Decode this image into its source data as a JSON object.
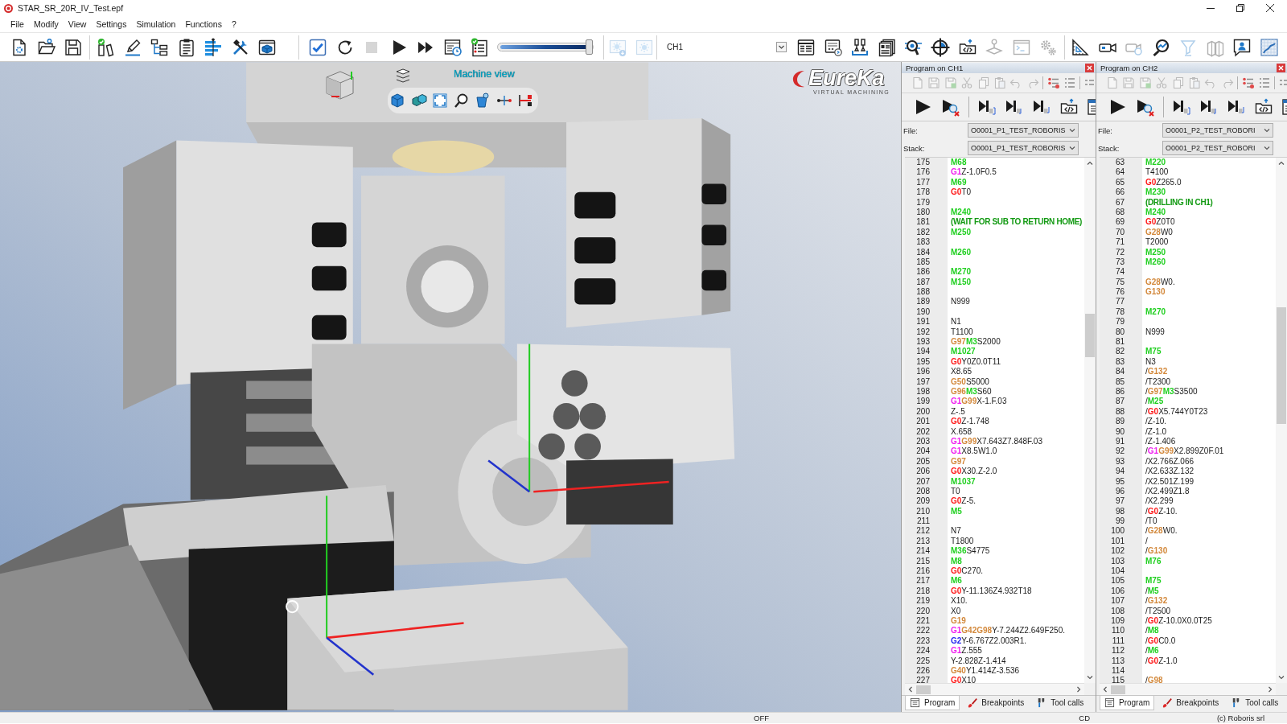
{
  "window": {
    "title": "STAR_SR_20R_IV_Test.epf"
  },
  "menu": [
    "File",
    "Modify",
    "View",
    "Settings",
    "Simulation",
    "Functions",
    "?"
  ],
  "toolbar": [
    {
      "buttons": [
        {
          "disabled": false
        },
        {
          "disabled": false
        },
        {
          "disabled": false
        }
      ]
    },
    {
      "buttons": [
        {
          "disabled": false
        },
        {
          "disabled": false
        },
        {
          "disabled": false
        },
        {
          "disabled": false
        },
        {
          "disabled": false
        },
        {
          "disabled": false
        },
        {
          "disabled": false
        }
      ]
    },
    {
      "buttons": [
        {
          "disabled": false
        },
        {
          "disabled": false
        },
        {
          "disabled": true
        },
        {
          "disabled": false
        },
        {
          "disabled": false
        },
        {
          "disabled": false
        },
        {
          "disabled": false
        }
      ],
      "slider": {
        "level": 1
      }
    },
    {
      "buttons": [
        {
          "disabled": true
        },
        {
          "disabled": true
        }
      ]
    },
    {
      "select": {
        "value": "CH1"
      },
      "buttons": [
        {
          "disabled": false
        },
        {
          "disabled": false
        },
        {
          "disabled": false
        },
        {
          "disabled": false
        },
        {
          "disabled": false
        },
        {
          "disabled": false
        },
        {
          "disabled": false
        },
        {
          "disabled": true
        },
        {
          "disabled": true
        },
        {
          "disabled": true
        }
      ]
    },
    {
      "buttons": [
        {
          "disabled": false
        },
        {
          "disabled": false
        },
        {
          "disabled": true
        },
        {
          "disabled": false
        },
        {
          "disabled": true
        },
        {
          "disabled": true
        },
        {
          "disabled": false
        },
        {
          "disabled": false
        }
      ]
    }
  ],
  "viewport": {
    "title": "Machine view",
    "logo": {
      "name": "EureKa",
      "tagline": "VIRTUAL MACHINING"
    }
  },
  "panels": [
    {
      "title": "Program on CH1",
      "edit_tools": [
        {
          "disabled": true
        },
        {
          "disabled": true
        },
        {
          "disabled": true
        },
        {
          "disabled": true
        },
        {
          "disabled": true
        },
        {
          "disabled": true
        },
        {
          "disabled": true
        },
        {
          "disabled": true
        },
        {
          "disabled": false
        },
        {
          "disabled": false
        },
        {
          "disabled": false
        }
      ],
      "file": {
        "label": "File:",
        "value": "O0001_P1_TEST_ROBORIS"
      },
      "stack": {
        "label": "Stack:",
        "value": "O0001_P1_TEST_ROBORIS"
      },
      "lines": [
        {
          "number": "175",
          "code": [
            {
              "kind": "m",
              "text": "M68"
            }
          ]
        },
        {
          "number": "176",
          "code": [
            {
              "kind": "g1",
              "text": "G1"
            },
            {
              "kind": "text",
              "text": "Z-1.0F0.5"
            }
          ]
        },
        {
          "number": "177",
          "code": [
            {
              "kind": "m",
              "text": "M69"
            }
          ]
        },
        {
          "number": "178",
          "code": [
            {
              "kind": "g0",
              "text": "G0"
            },
            {
              "kind": "text",
              "text": "T0"
            }
          ]
        },
        {
          "number": "179"
        },
        {
          "number": "180",
          "code": [
            {
              "kind": "m",
              "text": "M240"
            }
          ]
        },
        {
          "number": "181",
          "code": [
            {
              "kind": "comment",
              "text": "(WAIT FOR SUB TO RETURN HOME)"
            }
          ]
        },
        {
          "number": "182",
          "code": [
            {
              "kind": "m",
              "text": "M250"
            }
          ]
        },
        {
          "number": "183"
        },
        {
          "number": "184",
          "code": [
            {
              "kind": "m",
              "text": "M260"
            }
          ]
        },
        {
          "number": "185"
        },
        {
          "number": "186",
          "code": [
            {
              "kind": "m",
              "text": "M270"
            }
          ]
        },
        {
          "number": "187",
          "code": [
            {
              "kind": "m",
              "text": "M150"
            }
          ]
        },
        {
          "number": "188"
        },
        {
          "number": "189",
          "code": [
            {
              "kind": "text",
              "text": "N999"
            }
          ]
        },
        {
          "number": "190"
        },
        {
          "number": "191",
          "code": [
            {
              "kind": "text",
              "text": "N1"
            }
          ]
        },
        {
          "number": "192",
          "code": [
            {
              "kind": "text",
              "text": "T1100"
            }
          ]
        },
        {
          "number": "193",
          "code": [
            {
              "kind": "g",
              "text": "G97"
            },
            {
              "kind": "m",
              "text": "M3"
            },
            {
              "kind": "text",
              "text": "S2000"
            }
          ]
        },
        {
          "number": "194",
          "code": [
            {
              "kind": "m",
              "text": "M1027"
            }
          ]
        },
        {
          "number": "195",
          "code": [
            {
              "kind": "g0",
              "text": "G0"
            },
            {
              "kind": "text",
              "text": "Y0Z0.0T11"
            }
          ]
        },
        {
          "number": "196",
          "code": [
            {
              "kind": "text",
              "text": "X8.65"
            }
          ]
        },
        {
          "number": "197",
          "code": [
            {
              "kind": "g",
              "text": "G50"
            },
            {
              "kind": "text",
              "text": "S5000"
            }
          ]
        },
        {
          "number": "198",
          "code": [
            {
              "kind": "g",
              "text": "G96"
            },
            {
              "kind": "m",
              "text": "M3"
            },
            {
              "kind": "text",
              "text": "S60"
            }
          ]
        },
        {
          "number": "199",
          "code": [
            {
              "kind": "g1",
              "text": "G1"
            },
            {
              "kind": "g",
              "text": "G99"
            },
            {
              "kind": "text",
              "text": "X-1.F.03"
            }
          ]
        },
        {
          "number": "200",
          "code": [
            {
              "kind": "text",
              "text": "Z-.5"
            }
          ]
        },
        {
          "number": "201",
          "code": [
            {
              "kind": "g0",
              "text": "G0"
            },
            {
              "kind": "text",
              "text": "Z-1.748"
            }
          ]
        },
        {
          "number": "202",
          "code": [
            {
              "kind": "text",
              "text": "X.658"
            }
          ]
        },
        {
          "number": "203",
          "code": [
            {
              "kind": "g1",
              "text": "G1"
            },
            {
              "kind": "g",
              "text": "G99"
            },
            {
              "kind": "text",
              "text": "X7.643Z7.848F.03"
            }
          ]
        },
        {
          "number": "204",
          "code": [
            {
              "kind": "g1",
              "text": "G1"
            },
            {
              "kind": "text",
              "text": "X8.5W1.0"
            }
          ]
        },
        {
          "number": "205",
          "code": [
            {
              "kind": "g",
              "text": "G97"
            }
          ]
        },
        {
          "number": "206",
          "code": [
            {
              "kind": "g0",
              "text": "G0"
            },
            {
              "kind": "text",
              "text": "X30.Z-2.0"
            }
          ]
        },
        {
          "number": "207",
          "code": [
            {
              "kind": "m",
              "text": "M1037"
            }
          ]
        },
        {
          "number": "208",
          "code": [
            {
              "kind": "text",
              "text": "T0"
            }
          ]
        },
        {
          "number": "209",
          "code": [
            {
              "kind": "g0",
              "text": "G0"
            },
            {
              "kind": "text",
              "text": "Z-5."
            }
          ]
        },
        {
          "number": "210",
          "code": [
            {
              "kind": "m",
              "text": "M5"
            }
          ]
        },
        {
          "number": "211"
        },
        {
          "number": "212",
          "code": [
            {
              "kind": "text",
              "text": "N7"
            }
          ]
        },
        {
          "number": "213",
          "code": [
            {
              "kind": "text",
              "text": "T1800"
            }
          ]
        },
        {
          "number": "214",
          "code": [
            {
              "kind": "m",
              "text": "M36"
            },
            {
              "kind": "text",
              "text": "S4775"
            }
          ]
        },
        {
          "number": "215",
          "code": [
            {
              "kind": "m",
              "text": "M8"
            }
          ]
        },
        {
          "number": "216",
          "code": [
            {
              "kind": "g0",
              "text": "G0"
            },
            {
              "kind": "text",
              "text": "C270."
            }
          ]
        },
        {
          "number": "217",
          "code": [
            {
              "kind": "m",
              "text": "M6"
            }
          ]
        },
        {
          "number": "218",
          "code": [
            {
              "kind": "g0",
              "text": "G0"
            },
            {
              "kind": "text",
              "text": "Y-11.136Z4.932T18"
            }
          ]
        },
        {
          "number": "219",
          "code": [
            {
              "kind": "text",
              "text": "X10."
            }
          ]
        },
        {
          "number": "220",
          "code": [
            {
              "kind": "text",
              "text": "X0"
            }
          ]
        },
        {
          "number": "221",
          "code": [
            {
              "kind": "g",
              "text": "G19"
            }
          ]
        },
        {
          "number": "222",
          "code": [
            {
              "kind": "g1",
              "text": "G1"
            },
            {
              "kind": "g",
              "text": "G42G98"
            },
            {
              "kind": "text",
              "text": "Y-7.244Z2.649F250."
            }
          ]
        },
        {
          "number": "223",
          "code": [
            {
              "kind": "g2",
              "text": "G2"
            },
            {
              "kind": "text",
              "text": "Y-6.767Z2.003R1."
            }
          ]
        },
        {
          "number": "224",
          "code": [
            {
              "kind": "g1",
              "text": "G1"
            },
            {
              "kind": "text",
              "text": "Z.555"
            }
          ]
        },
        {
          "number": "225",
          "code": [
            {
              "kind": "text",
              "text": "Y-2.828Z-1.414"
            }
          ]
        },
        {
          "number": "226",
          "code": [
            {
              "kind": "g",
              "text": "G40"
            },
            {
              "kind": "text",
              "text": "Y1.414Z-3.536"
            }
          ]
        },
        {
          "number": "227",
          "code": [
            {
              "kind": "g0",
              "text": "G0"
            },
            {
              "kind": "text",
              "text": "X10"
            }
          ]
        }
      ],
      "tabs": [
        {
          "label": "Program",
          "selected": true
        },
        {
          "label": "Breakpoints",
          "selected": false
        },
        {
          "label": "Tool calls",
          "selected": false
        }
      ]
    },
    {
      "title": "Program on CH2",
      "edit_tools": [
        {
          "disabled": true
        },
        {
          "disabled": true
        },
        {
          "disabled": true
        },
        {
          "disabled": true
        },
        {
          "disabled": true
        },
        {
          "disabled": true
        },
        {
          "disabled": true
        },
        {
          "disabled": true
        },
        {
          "disabled": false
        },
        {
          "disabled": false
        },
        {
          "disabled": false
        }
      ],
      "file": {
        "label": "File:",
        "value": "O0001_P2_TEST_ROBORI"
      },
      "stack": {
        "label": "Stack:",
        "value": "O0001_P2_TEST_ROBORI"
      },
      "lines": [
        {
          "number": "63",
          "code": [
            {
              "kind": "m",
              "text": "M220"
            }
          ]
        },
        {
          "number": "64",
          "code": [
            {
              "kind": "text",
              "text": "T4100"
            }
          ]
        },
        {
          "number": "65",
          "code": [
            {
              "kind": "g0",
              "text": "G0"
            },
            {
              "kind": "text",
              "text": "Z265.0"
            }
          ]
        },
        {
          "number": "66",
          "code": [
            {
              "kind": "m",
              "text": "M230"
            }
          ]
        },
        {
          "number": "67",
          "code": [
            {
              "kind": "comment",
              "text": "(DRILLING IN CH1)"
            }
          ]
        },
        {
          "number": "68",
          "code": [
            {
              "kind": "m",
              "text": "M240"
            }
          ]
        },
        {
          "number": "69",
          "code": [
            {
              "kind": "g0",
              "text": "G0"
            },
            {
              "kind": "text",
              "text": "Z0T0"
            }
          ]
        },
        {
          "number": "70",
          "code": [
            {
              "kind": "g",
              "text": "G28"
            },
            {
              "kind": "text",
              "text": "W0"
            }
          ]
        },
        {
          "number": "71",
          "code": [
            {
              "kind": "text",
              "text": "T2000"
            }
          ]
        },
        {
          "number": "72",
          "code": [
            {
              "kind": "m",
              "text": "M250"
            }
          ]
        },
        {
          "number": "73",
          "code": [
            {
              "kind": "m",
              "text": "M260"
            }
          ]
        },
        {
          "number": "74"
        },
        {
          "number": "75",
          "code": [
            {
              "kind": "g",
              "text": "G28"
            },
            {
              "kind": "text",
              "text": "W0."
            }
          ]
        },
        {
          "number": "76",
          "code": [
            {
              "kind": "g",
              "text": "G130"
            }
          ]
        },
        {
          "number": "77"
        },
        {
          "number": "78",
          "code": [
            {
              "kind": "m",
              "text": "M270"
            }
          ]
        },
        {
          "number": "79"
        },
        {
          "number": "80",
          "code": [
            {
              "kind": "text",
              "text": "N999"
            }
          ]
        },
        {
          "number": "81"
        },
        {
          "number": "82",
          "code": [
            {
              "kind": "m",
              "text": "M75"
            }
          ]
        },
        {
          "number": "83",
          "code": [
            {
              "kind": "text",
              "text": "N3"
            }
          ]
        },
        {
          "number": "84",
          "code": [
            {
              "kind": "text",
              "text": "/"
            },
            {
              "kind": "g",
              "text": "G132"
            }
          ]
        },
        {
          "number": "85",
          "code": [
            {
              "kind": "text",
              "text": "/T2300"
            }
          ]
        },
        {
          "number": "86",
          "code": [
            {
              "kind": "text",
              "text": "/"
            },
            {
              "kind": "g",
              "text": "G97"
            },
            {
              "kind": "m",
              "text": "M3"
            },
            {
              "kind": "text",
              "text": "S3500"
            }
          ]
        },
        {
          "number": "87",
          "code": [
            {
              "kind": "text",
              "text": "/"
            },
            {
              "kind": "m",
              "text": "M25"
            }
          ]
        },
        {
          "number": "88",
          "code": [
            {
              "kind": "text",
              "text": "/"
            },
            {
              "kind": "g0",
              "text": "G0"
            },
            {
              "kind": "text",
              "text": "X5.744Y0T23"
            }
          ]
        },
        {
          "number": "89",
          "code": [
            {
              "kind": "text",
              "text": "/Z-10."
            }
          ]
        },
        {
          "number": "90",
          "code": [
            {
              "kind": "text",
              "text": "/Z-1.0"
            }
          ]
        },
        {
          "number": "91",
          "code": [
            {
              "kind": "text",
              "text": "/Z-1.406"
            }
          ]
        },
        {
          "number": "92",
          "code": [
            {
              "kind": "text",
              "text": "/"
            },
            {
              "kind": "g1",
              "text": "G1"
            },
            {
              "kind": "g",
              "text": "G99"
            },
            {
              "kind": "text",
              "text": "X2.899Z0F.01"
            }
          ]
        },
        {
          "number": "93",
          "code": [
            {
              "kind": "text",
              "text": "/X2.766Z.066"
            }
          ]
        },
        {
          "number": "94",
          "code": [
            {
              "kind": "text",
              "text": "/X2.633Z.132"
            }
          ]
        },
        {
          "number": "95",
          "code": [
            {
              "kind": "text",
              "text": "/X2.501Z.199"
            }
          ]
        },
        {
          "number": "96",
          "code": [
            {
              "kind": "text",
              "text": "/X2.499Z1.8"
            }
          ]
        },
        {
          "number": "97",
          "code": [
            {
              "kind": "text",
              "text": "/X2.299"
            }
          ]
        },
        {
          "number": "98",
          "code": [
            {
              "kind": "text",
              "text": "/"
            },
            {
              "kind": "g0",
              "text": "G0"
            },
            {
              "kind": "text",
              "text": "Z-10."
            }
          ]
        },
        {
          "number": "99",
          "code": [
            {
              "kind": "text",
              "text": "/T0"
            }
          ]
        },
        {
          "number": "100",
          "code": [
            {
              "kind": "text",
              "text": "/"
            },
            {
              "kind": "g",
              "text": "G28"
            },
            {
              "kind": "text",
              "text": "W0."
            }
          ]
        },
        {
          "number": "101",
          "code": [
            {
              "kind": "text",
              "text": "/"
            }
          ]
        },
        {
          "number": "102",
          "code": [
            {
              "kind": "text",
              "text": "/"
            },
            {
              "kind": "g",
              "text": "G130"
            }
          ]
        },
        {
          "number": "103",
          "code": [
            {
              "kind": "m",
              "text": "M76"
            }
          ]
        },
        {
          "number": "104"
        },
        {
          "number": "105",
          "code": [
            {
              "kind": "m",
              "text": "M75"
            }
          ]
        },
        {
          "number": "106",
          "code": [
            {
              "kind": "text",
              "text": "/"
            },
            {
              "kind": "m",
              "text": "M5"
            }
          ]
        },
        {
          "number": "107",
          "code": [
            {
              "kind": "text",
              "text": "/"
            },
            {
              "kind": "g",
              "text": "G132"
            }
          ]
        },
        {
          "number": "108",
          "code": [
            {
              "kind": "text",
              "text": "/T2500"
            }
          ]
        },
        {
          "number": "109",
          "code": [
            {
              "kind": "text",
              "text": "/"
            },
            {
              "kind": "g0",
              "text": "G0"
            },
            {
              "kind": "text",
              "text": "Z-10.0X0.0T25"
            }
          ]
        },
        {
          "number": "110",
          "code": [
            {
              "kind": "text",
              "text": "/"
            },
            {
              "kind": "m",
              "text": "M8"
            }
          ]
        },
        {
          "number": "111",
          "code": [
            {
              "kind": "text",
              "text": "/"
            },
            {
              "kind": "g0",
              "text": "G0"
            },
            {
              "kind": "text",
              "text": "C0.0"
            }
          ]
        },
        {
          "number": "112",
          "code": [
            {
              "kind": "text",
              "text": "/"
            },
            {
              "kind": "m",
              "text": "M6"
            }
          ]
        },
        {
          "number": "113",
          "code": [
            {
              "kind": "text",
              "text": "/"
            },
            {
              "kind": "g0",
              "text": "G0"
            },
            {
              "kind": "text",
              "text": "Z-1.0"
            }
          ]
        },
        {
          "number": "114"
        },
        {
          "number": "115",
          "code": [
            {
              "kind": "text",
              "text": "/"
            },
            {
              "kind": "g",
              "text": "G98"
            }
          ]
        }
      ],
      "tabs": [
        {
          "label": "Program",
          "selected": true
        },
        {
          "label": "Breakpoints",
          "selected": false
        },
        {
          "label": "Tool calls",
          "selected": false
        }
      ]
    }
  ],
  "status_bar": [
    "OFF",
    "CD",
    "(c) Roboris srl"
  ]
}
